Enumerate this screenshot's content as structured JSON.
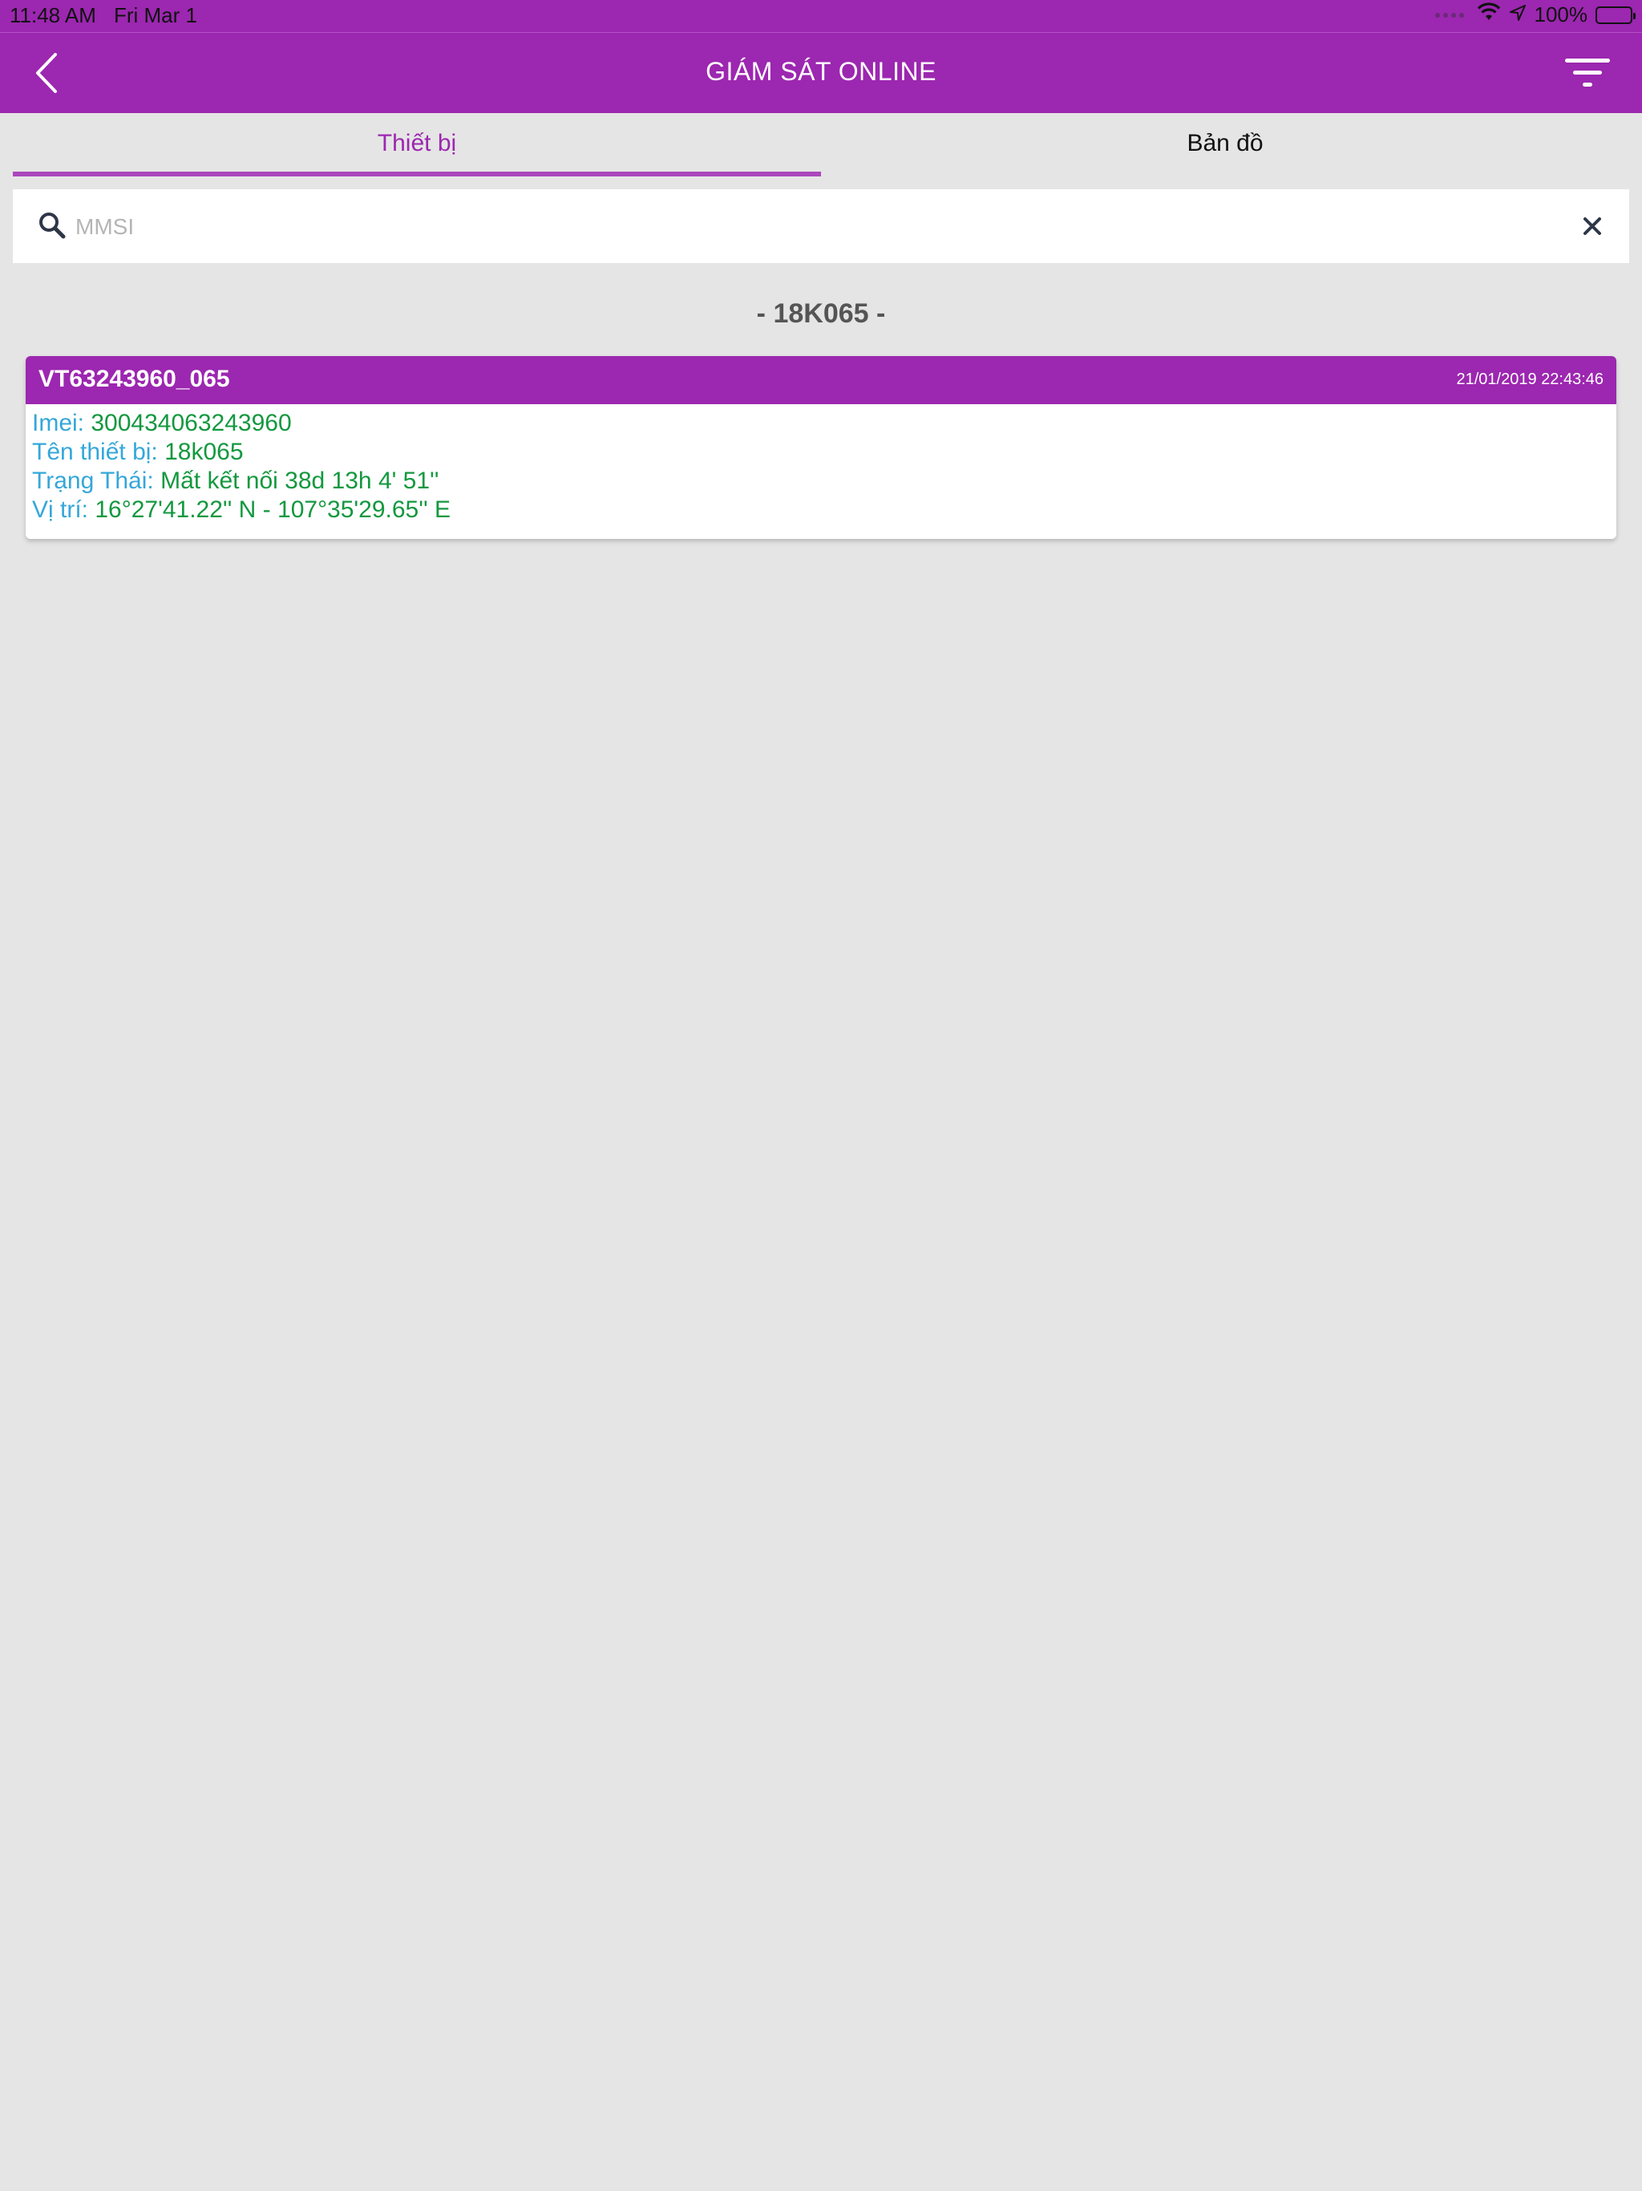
{
  "status_bar": {
    "time": "11:48 AM",
    "date": "Fri Mar 1",
    "battery": "100%"
  },
  "header": {
    "title": "GIÁM SÁT ONLINE",
    "back_icon": "chevron-left-icon",
    "filter_icon": "filter-icon"
  },
  "tabs": [
    {
      "label": "Thiết bị",
      "active": true
    },
    {
      "label": "Bản đồ",
      "active": false
    }
  ],
  "search": {
    "placeholder": "MMSI",
    "value": ""
  },
  "group": {
    "title": "- 18K065 -"
  },
  "device": {
    "name": "VT63243960_065",
    "timestamp": "21/01/2019 22:43:46",
    "fields": [
      {
        "label": "Imei:",
        "value": "300434063243960"
      },
      {
        "label": "Tên thiết bị:",
        "value": "18k065"
      },
      {
        "label": "Trạng Thái:",
        "value": "Mất kết nối 38d 13h 4' 51''"
      },
      {
        "label": "Vị trí:",
        "value": "16°27'41.22'' N - 107°35'29.65'' E"
      }
    ]
  },
  "colors": {
    "primary": "#9c27b0",
    "tab_indicator": "#ab47bc",
    "label": "#35a7d9",
    "value": "#13983f",
    "background": "#e5e5e5"
  }
}
